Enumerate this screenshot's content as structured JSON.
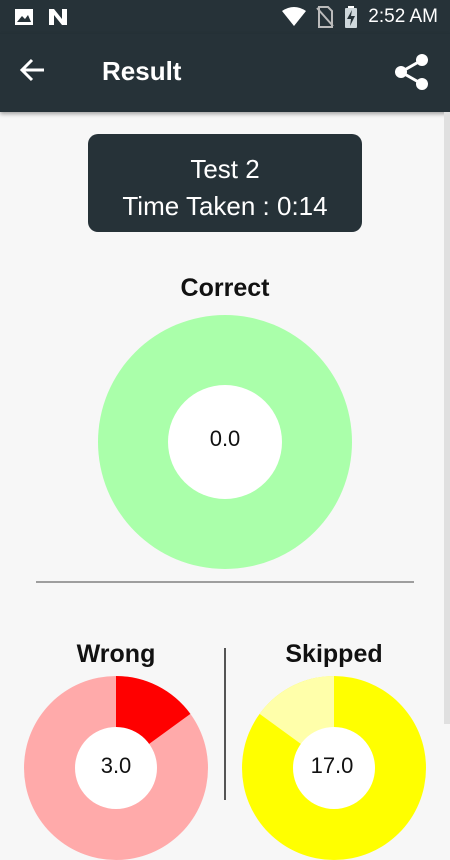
{
  "status_bar": {
    "time": "2:52 AM",
    "icons": [
      "image-icon",
      "n-notification-icon",
      "wifi-icon",
      "no-sim-icon",
      "battery-charging-icon"
    ]
  },
  "app_bar": {
    "title": "Result",
    "back_icon": "arrow-left-icon",
    "share_icon": "share-icon"
  },
  "summary": {
    "test_name": "Test 2",
    "time_taken": "Time Taken : 0:14"
  },
  "correct": {
    "label": "Correct",
    "value": "0.0",
    "color": "#aaffaa"
  },
  "wrong": {
    "label": "Wrong",
    "value": "3.0",
    "color_light": "#ffaaaa",
    "color_dark": "#ff0000"
  },
  "skipped": {
    "label": "Skipped",
    "value": "17.0",
    "color_light": "#ffffaa",
    "color_dark": "#ffff00"
  }
}
